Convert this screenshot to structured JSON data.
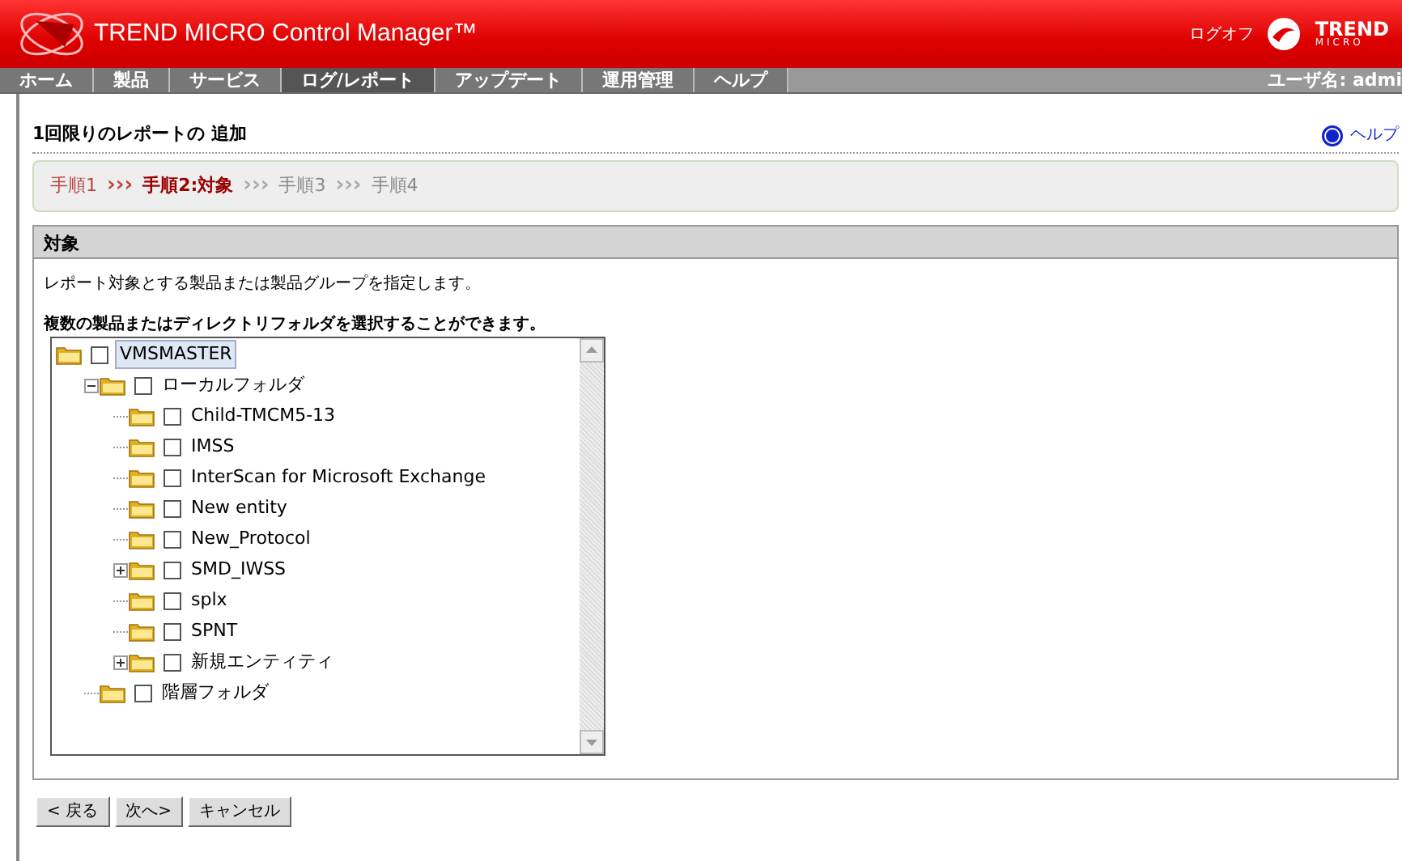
{
  "header": {
    "title": "TREND MICRO Control Manager™",
    "logout": "ログオフ",
    "logo_main": "TREND",
    "logo_sub": "MICRO"
  },
  "nav": {
    "tabs": [
      {
        "label": "ホーム",
        "selected": false
      },
      {
        "label": "製品",
        "selected": false
      },
      {
        "label": "サービス",
        "selected": false
      },
      {
        "label": "ログ/レポート",
        "selected": true
      },
      {
        "label": "アップデート",
        "selected": false
      },
      {
        "label": "運用管理",
        "selected": false
      },
      {
        "label": "ヘルプ",
        "selected": false
      }
    ],
    "user": "ユーザ名: admi"
  },
  "page": {
    "title": "1回限りのレポートの 追加",
    "help": "ヘルプ"
  },
  "steps": [
    {
      "kind": "step",
      "label": "手順1",
      "completed": true,
      "selected": false
    },
    {
      "kind": "separator",
      "label": "›››",
      "completed": true
    },
    {
      "kind": "step",
      "label": "手順2:対象",
      "completed": false,
      "selected": true
    },
    {
      "kind": "separator",
      "label": "›››",
      "completed": false
    },
    {
      "kind": "step",
      "label": "手順3",
      "completed": false,
      "selected": false
    },
    {
      "kind": "separator",
      "label": "›››",
      "completed": false
    },
    {
      "kind": "step",
      "label": "手順4",
      "completed": false,
      "selected": false
    }
  ],
  "section": {
    "title": "対象",
    "description": "レポート対象とする製品または製品グループを指定します。",
    "instruction": "複数の製品またはディレクトリフォルダを選択することができます。"
  },
  "tree": [
    {
      "label": "VMSMASTER",
      "checked": false,
      "selected": true,
      "children": [
        {
          "label": "ローカルフォルダ",
          "checked": false,
          "selected": false,
          "expanded": true,
          "children": [
            {
              "label": "Child-TMCM5-13",
              "checked": false,
              "selected": false
            },
            {
              "label": "IMSS",
              "checked": false,
              "selected": false
            },
            {
              "label": "InterScan for Microsoft Exchange",
              "checked": false,
              "selected": false
            },
            {
              "label": "New entity",
              "checked": false,
              "selected": false
            },
            {
              "label": "New_Protocol",
              "checked": false,
              "selected": false
            },
            {
              "label": "SMD_IWSS",
              "checked": false,
              "selected": false,
              "expanded": false
            },
            {
              "label": "splx",
              "checked": false,
              "selected": false
            },
            {
              "label": "SPNT",
              "checked": false,
              "selected": false
            },
            {
              "label": "新規エンティティ",
              "checked": false,
              "selected": false,
              "expanded": false
            }
          ]
        },
        {
          "label": "階層フォルダ",
          "checked": false,
          "selected": false
        }
      ]
    }
  ],
  "buttons": [
    "< 戻る",
    "次へ>",
    "キャンセル"
  ]
}
